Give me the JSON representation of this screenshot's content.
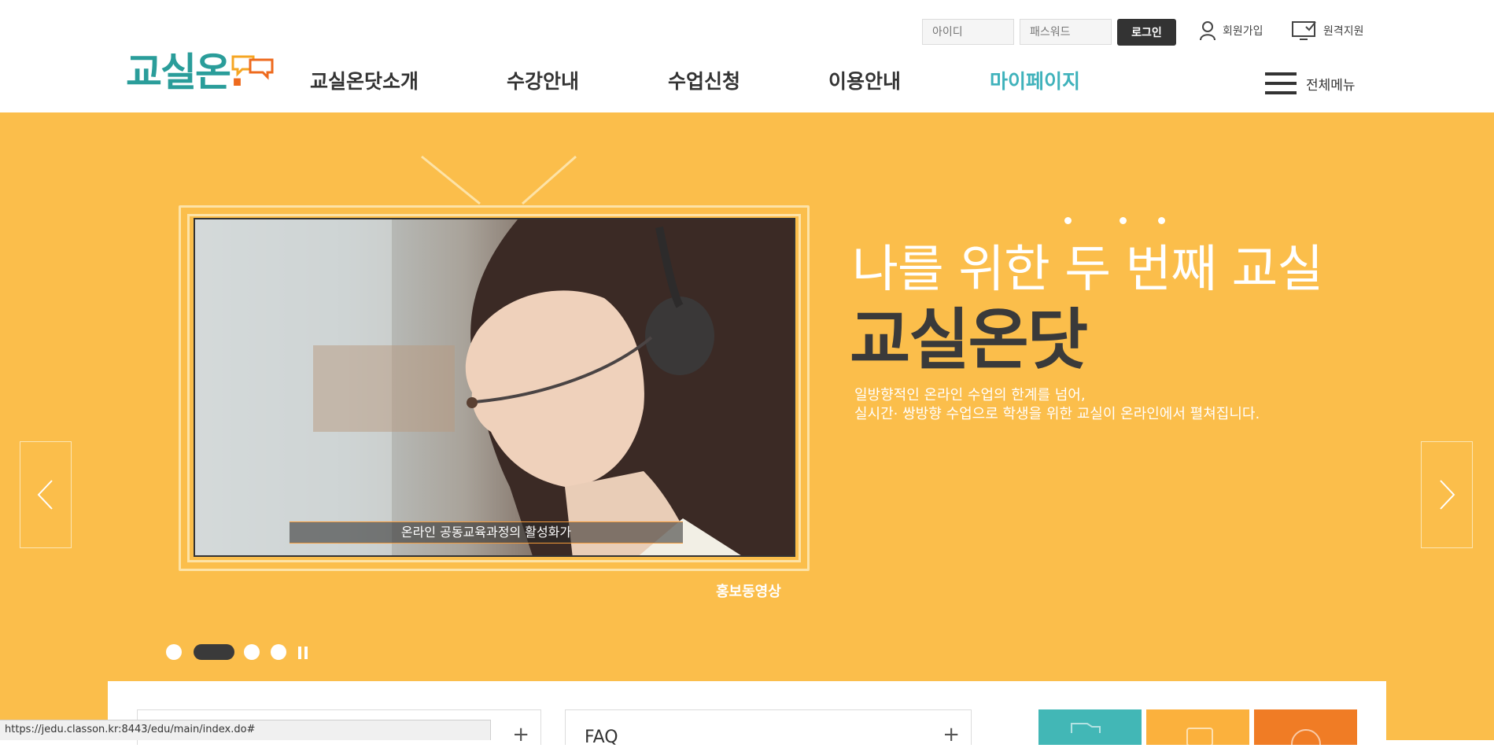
{
  "header": {
    "logo_text": "교실온",
    "logo_dot": ".",
    "login": {
      "id_placeholder": "아이디",
      "pw_placeholder": "패스워드",
      "button_label": "로그인"
    },
    "util": {
      "join_label": "회원가입",
      "remote_label": "원격지원"
    },
    "gnb": [
      {
        "label": "교실온닷소개"
      },
      {
        "label": "수강안내"
      },
      {
        "label": "수업신청"
      },
      {
        "label": "이용안내"
      },
      {
        "label": "마이페이지"
      }
    ],
    "all_menu_label": "전체메뉴"
  },
  "hero": {
    "video_caption": "온라인 공동교육과정의 활성화가",
    "promo_label": "홍보동영상",
    "subtitle": "나를 위한 두 번째 교실",
    "title": "교실온닷",
    "desc_line1": "일방향적인 온라인 수업의 한계를 넘어,",
    "desc_line2": "실시간· 쌍방향 수업으로 학생을 위한 교실이 온라인에서 펼쳐집니다.",
    "slide_count": 4,
    "active_slide": 2
  },
  "bottom": {
    "box2_title": "FAQ",
    "plus_symbol": "+"
  },
  "status_bar": {
    "url": "https://jedu.classon.kr:8443/edu/main/index.do#"
  },
  "colors": {
    "brand_teal": "#2a9d9a",
    "brand_orange": "#ee6a1d",
    "active_menu": "#3fb2bb",
    "hero_bg": "#fbbe4b"
  },
  "icons": [
    "user-icon",
    "monitor-check-icon",
    "hamburger-icon",
    "chevron-left-icon",
    "chevron-right-icon",
    "pause-icon"
  ]
}
